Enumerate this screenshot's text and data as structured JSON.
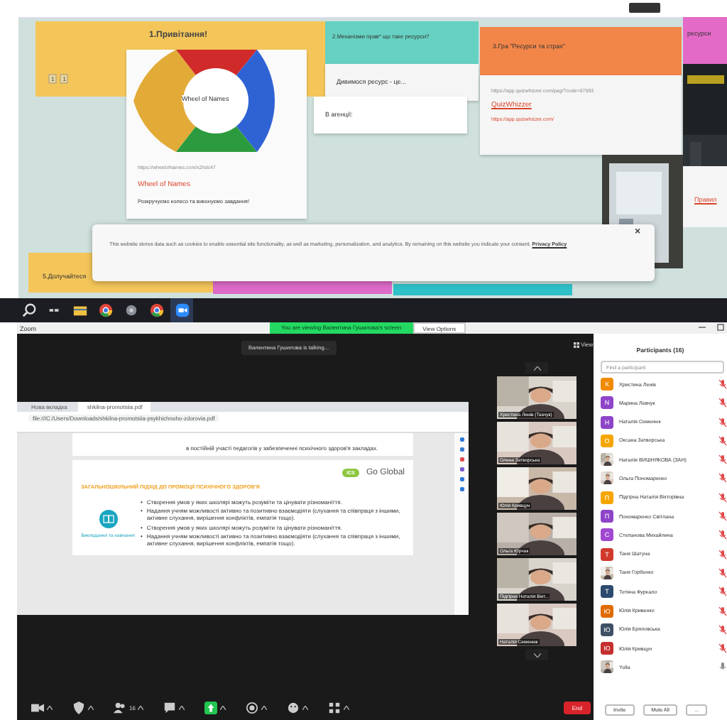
{
  "board": {
    "section_1": {
      "title": "1.Привітання!",
      "reactions": [
        "1",
        "1"
      ],
      "card": {
        "center_label": "Wheel of Names",
        "url": "https://wheelofnames.com/x2hdc47",
        "link": "Wheel of Names",
        "description": "Розкручуємо колесо та виконуємо завдання!"
      }
    },
    "section_2": {
      "title": "2.Механізми прав* що таке ресурси?",
      "posts": [
        "Дивимося ресурс - це...",
        "В агенції:"
      ]
    },
    "section_3": {
      "title": "3.Гра \"Ресурси та страх\"",
      "url": "https://app.quizwhizzer.com/pag/?code=67593",
      "link": "QuizWhizzer",
      "link_url": "https://app.quizwhizzer.com/"
    },
    "section_4": {
      "title": "ресурси",
      "link": "Правил"
    },
    "section_5": {
      "title": "5.Долучайтеся"
    },
    "cookie_banner": {
      "text": "This website stores data such as cookies to enable essential site functionality, as well as marketing, personalization, and analytics. By remaining on this website you indicate your consent.",
      "link": "Privacy Policy",
      "close": "×"
    }
  },
  "zoom": {
    "title": "Zoom",
    "banner": "You are viewing Валентина Гушилова's screen",
    "view_options": "View Options",
    "talking": "Валентина Гушилова is talking...",
    "view_button": "View",
    "browser": {
      "tabs": [
        {
          "label": "Нова вкладка",
          "selected": false
        },
        {
          "label": "shkilna-promotsiia.pdf",
          "selected": true
        }
      ],
      "address": "file:///C:/Users/Downloads/shkilna-promotsiia-psykhichnoho-zdorovia.pdf"
    },
    "pdf": {
      "top_text": "в постійній участі педагогів у забезпеченні психічного здоров'я закладах.",
      "logo_badge": "ICS",
      "logo_text": "Go Global",
      "heading": "ЗАГАЛЬНОШКІЛЬНИЙ ПІДХІД ДО ПРОМОЦІЇ ПСИХІЧНОГО ЗДОРОВ'Я",
      "side_label": "Викладання та навчання",
      "bullet_marker": "•",
      "bullets": [
        "Створення умов у яких школярі можуть розуміти та цінувати різноманіття.",
        "Надання учням можливості активно та позитивно взаємодіяти (слухання та співпраця з іншими, активне слухання, вирішення конфліктів, емпатія тощо).",
        "Створення умов у яких школярі можуть розуміти та цінувати різноманіття.",
        "Надання учням можливості активно та позитивно взаємодіяти (слухання та співпраця з іншими, активне слухання, вирішення конфліктів, емпатія тощо)."
      ]
    },
    "videos": [
      {
        "name": "Христина Ленів (Ткачук)"
      },
      {
        "name": "Олена Затворська"
      },
      {
        "name": "Юлія Кривцун"
      },
      {
        "name": "Ольга Юрчак"
      },
      {
        "name": "Підгірна Наталія Вікт..."
      },
      {
        "name": "Наталія Семенюк"
      }
    ],
    "toolbar": {
      "participants_count": "16",
      "end": "End"
    },
    "participants": {
      "title": "Participants (16)",
      "search_placeholder": "Find a participant",
      "items": [
        {
          "kind": "initial",
          "initial": "К",
          "color": "#f08a00",
          "name": "Христина Ленів",
          "muted": true
        },
        {
          "kind": "initial",
          "initial": "N",
          "color": "#8e44c8",
          "name": "Марина Левчук",
          "muted": true
        },
        {
          "kind": "initial",
          "initial": "Н",
          "color": "#8e44c8",
          "name": "Наталія Семенюк",
          "muted": true
        },
        {
          "kind": "initial",
          "initial": "О",
          "color": "#f5a500",
          "name": "Оксана Затворська",
          "muted": true
        },
        {
          "name": "Наталія ВИШНЯКОВА (ЗАН)",
          "muted": true
        },
        {
          "name": "Ольга Пономаренко",
          "muted": true
        },
        {
          "kind": "initial",
          "initial": "П",
          "color": "#f5a500",
          "name": "Підгірна Наталія Вікторівна",
          "muted": true
        },
        {
          "kind": "initial",
          "initial": "П",
          "color": "#8e44c8",
          "name": "Пономаренко Світлана",
          "muted": true
        },
        {
          "kind": "initial",
          "initial": "С",
          "color": "#a048d0",
          "name": "Степанова Михайлина",
          "muted": true
        },
        {
          "kind": "initial",
          "initial": "Т",
          "color": "#d0392b",
          "name": "Таня Шатуна",
          "muted": true
        },
        {
          "name": "Таня Горбенко",
          "muted": true
        },
        {
          "kind": "initial",
          "initial": "Т",
          "color": "#2c4a6e",
          "name": "Тетяна Фуркало",
          "muted": true
        },
        {
          "kind": "initial",
          "initial": "Ю",
          "color": "#e06c00",
          "name": "Юлія Кривенко",
          "muted": true
        },
        {
          "kind": "initial",
          "initial": "Ю",
          "color": "#3d5064",
          "name": "Юлія Бряловська",
          "muted": true
        },
        {
          "kind": "initial",
          "initial": "Ю",
          "color": "#c62f2f",
          "name": "Юлія Кривцун",
          "muted": true
        },
        {
          "name": "Yulia",
          "muted": false
        }
      ],
      "buttons": [
        "Invite",
        "Mute All",
        "..."
      ]
    }
  }
}
